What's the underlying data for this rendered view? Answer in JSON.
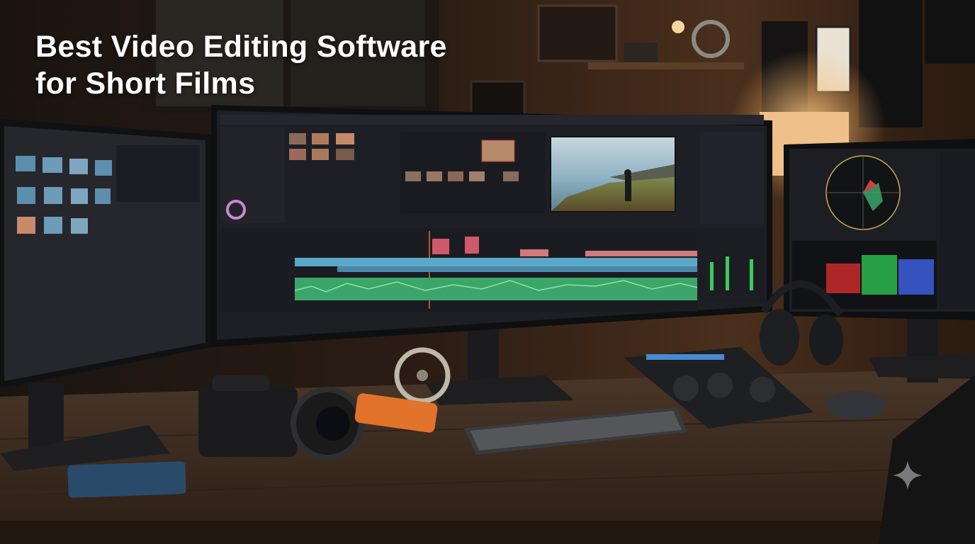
{
  "headline": {
    "line1": "Best Video Editing Software",
    "line2": "for Short Films"
  },
  "colors": {
    "wall_dark": "#1c1410",
    "wall_warm": "#5a3a24",
    "lamp_glow": "#f2b86a",
    "desk_wood": "#3e2e22",
    "screen_panel": "#1d1e24",
    "timeline_blue": "#5aa7c8",
    "timeline_red": "#d05a6a",
    "audio_green": "#3aa66a",
    "drive_orange": "#e2732a",
    "ssd_blue": "#2a4a6a"
  },
  "icons": [
    "sparkle-icon"
  ]
}
